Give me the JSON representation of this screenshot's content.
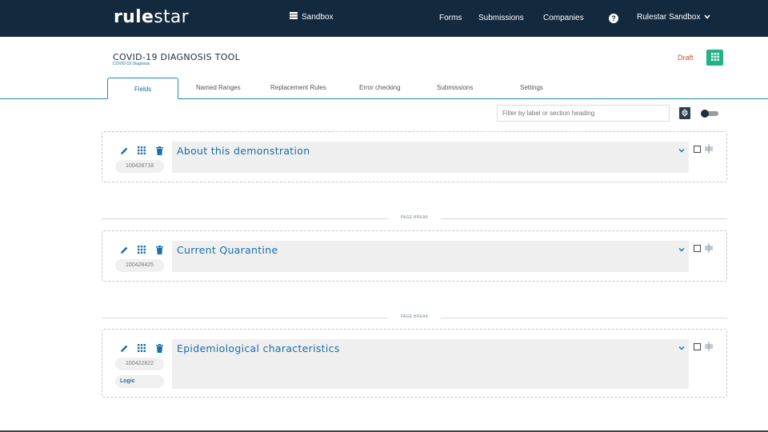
{
  "topbar": {
    "logo_bold": "rule",
    "logo_light": "star",
    "sandbox_label": "Sandbox",
    "links": [
      "Forms",
      "Submissions",
      "Companies"
    ],
    "help_glyph": "?",
    "account_label": "Rulestar Sandbox",
    "bg_color": "#13293d"
  },
  "header": {
    "title": "COVID-19 DIAGNOSIS TOOL",
    "subtitle": "COVID-19 Diagnosis",
    "status": "Draft",
    "status_color": "#c0553a",
    "accent_color": "#20b383"
  },
  "tabs": [
    {
      "label": "Fields",
      "active": true
    },
    {
      "label": "Named Ranges",
      "active": false
    },
    {
      "label": "Replacement Rules",
      "active": false
    },
    {
      "label": "Error checking",
      "active": false
    },
    {
      "label": "Submissions",
      "active": false
    },
    {
      "label": "Settings",
      "active": false
    }
  ],
  "filter": {
    "placeholder": "Filter by label or section heading",
    "value": ""
  },
  "page_break_label": "PAGE BREAK",
  "sections": [
    {
      "id": "100428718",
      "heading": "About this demonstration",
      "logic": null
    },
    {
      "id": "100428425",
      "heading": "Current Quarantine",
      "logic": null
    },
    {
      "id": "100422822",
      "heading": "Epidemiological characteristics",
      "logic": "Logic"
    }
  ],
  "icons": {
    "edit": "pencil-icon",
    "drag": "grid-icon",
    "delete": "trash-icon",
    "expand": "chevron-down-icon",
    "select": "checkbox",
    "move": "move-handle-icon",
    "sort": "sort-icon",
    "menu": "apps-grid-icon"
  }
}
